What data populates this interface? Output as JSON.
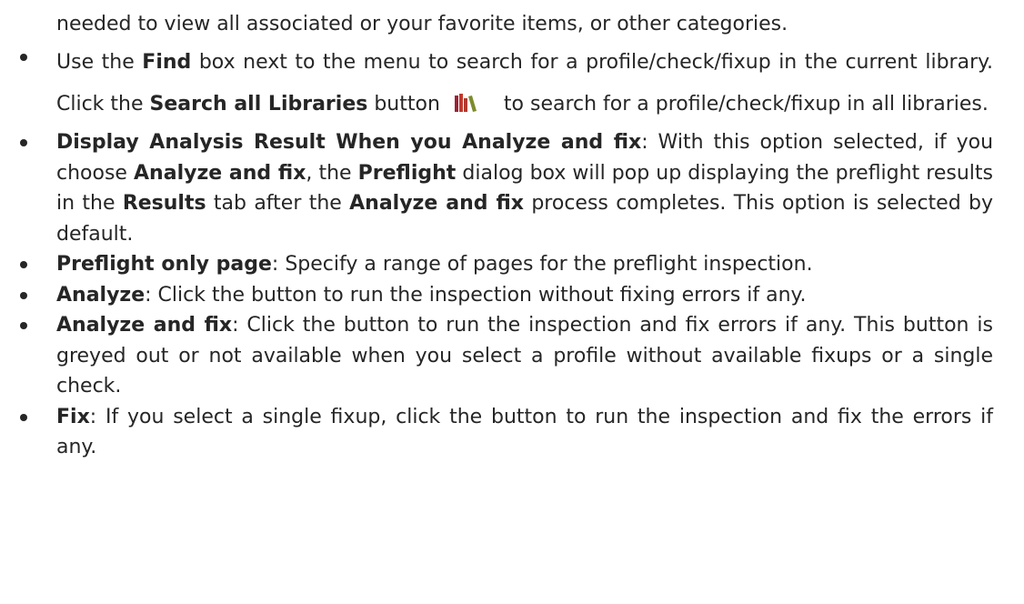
{
  "intro": "needed to view all associated or your favorite items, or other categories.",
  "items": [
    {
      "a": "Use the ",
      "b1": "Find",
      "c": " box next to the menu to search for a profile/check/fixup in the current library. Click the ",
      "b2": "Search all Libraries",
      "d": " button",
      "icon": "library-books-icon",
      "e": "to search for a profile/check/fixup in all libraries."
    },
    {
      "b1": "Display Analysis Result When you Analyze and fix",
      "a": ": With this option selected, if you choose ",
      "b2": "Analyze and fix",
      "c": ", the ",
      "b3": "Preflight",
      "d": " dialog box will pop up displaying the preflight results in the ",
      "b4": "Results",
      "e": " tab after the ",
      "b5": "Analyze and fix",
      "f": " process completes. This option is selected by default."
    },
    {
      "b1": "Preflight only page",
      "a": ": Specify a range of pages for the preflight inspection."
    },
    {
      "b1": "Analyze",
      "a": ": Click the button to run the inspection without fixing errors if any."
    },
    {
      "b1": "Analyze and fix",
      "a": ": Click the button to run the inspection and fix errors if any. This button is greyed out or not available when you select a profile without available fixups or a single check."
    },
    {
      "b1": "Fix",
      "a": ": If you select a single fixup, click the button to run the inspection and fix the errors if any."
    }
  ],
  "colors": {
    "text": "#262626",
    "icon_bars": [
      "#9b2335",
      "#c0392b",
      "#7d8c2a"
    ]
  }
}
